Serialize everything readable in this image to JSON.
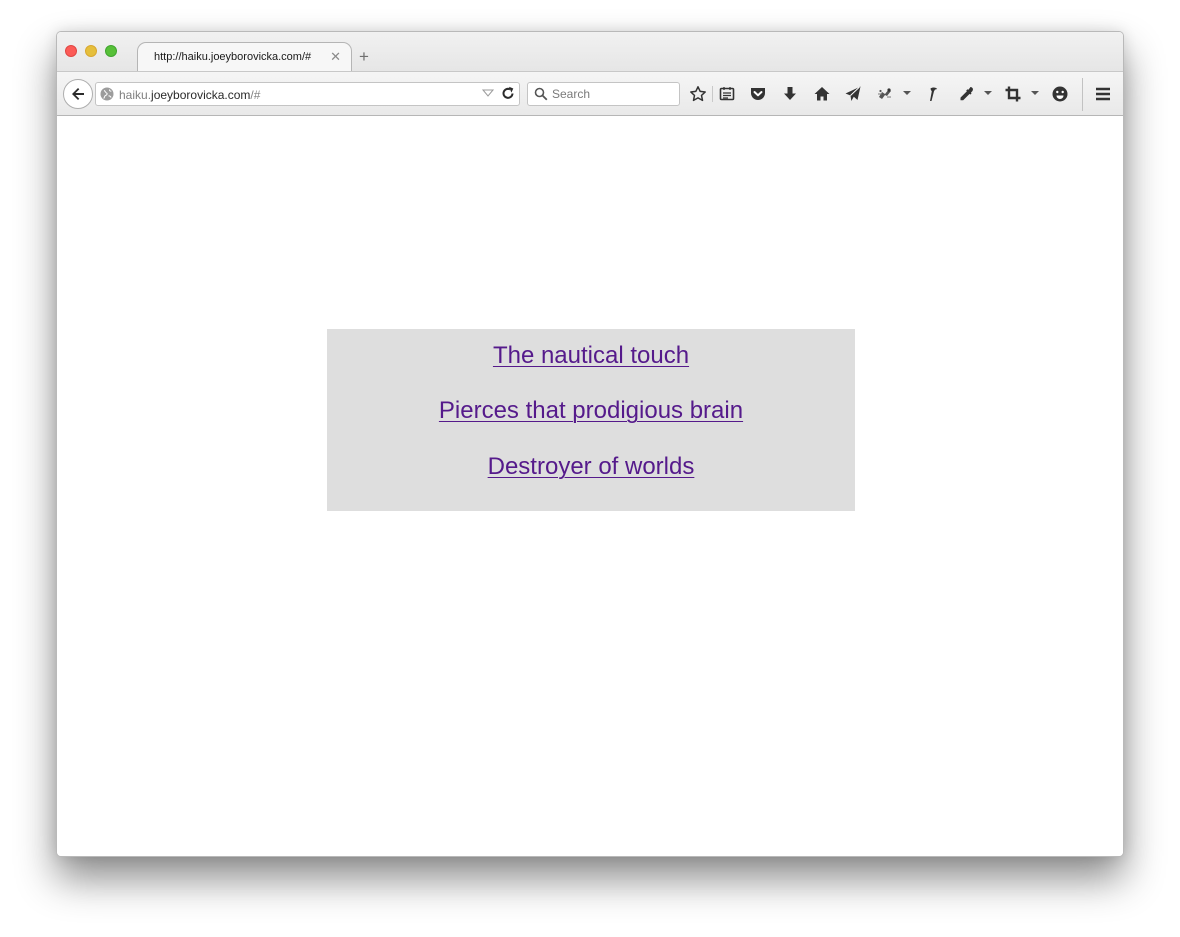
{
  "browser": {
    "tab": {
      "title": "http://haiku.joeyborovicka.com/#",
      "close_glyph": "✕"
    },
    "new_tab_glyph": "+",
    "url": {
      "prefix": "haiku.",
      "domain": "joeyborovicka.com",
      "path": "/#"
    },
    "search": {
      "placeholder": "Search"
    },
    "toolbar_icons": [
      "star-icon",
      "reading-list-icon",
      "pocket-icon",
      "download-icon",
      "home-icon",
      "send-icon",
      "extension-icon",
      "hammer-icon",
      "eyedropper-icon",
      "crop-icon",
      "emoji-icon",
      "hamburger-menu-icon"
    ]
  },
  "page": {
    "haiku": [
      {
        "text": "The nautical touch"
      },
      {
        "text": "Pierces that prodigious brain"
      },
      {
        "text": "Destroyer of worlds"
      }
    ]
  },
  "colors": {
    "link_visited": "#551a8b",
    "box_bg": "#dedede"
  }
}
